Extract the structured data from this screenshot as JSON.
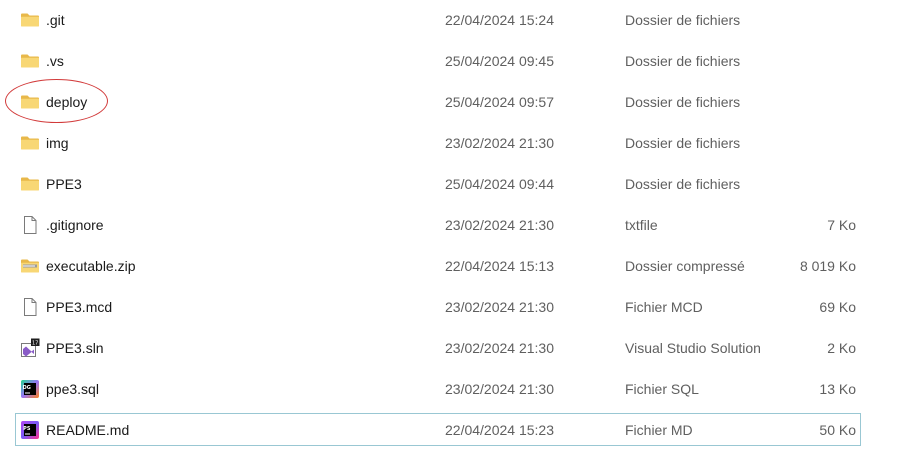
{
  "files": [
    {
      "icon": "folder-icon",
      "name": ".git",
      "date": "22/04/2024 15:24",
      "type": "Dossier de fichiers",
      "size": ""
    },
    {
      "icon": "folder-icon",
      "name": ".vs",
      "date": "25/04/2024 09:45",
      "type": "Dossier de fichiers",
      "size": ""
    },
    {
      "icon": "folder-icon",
      "name": "deploy",
      "date": "25/04/2024 09:57",
      "type": "Dossier de fichiers",
      "size": ""
    },
    {
      "icon": "folder-icon",
      "name": "img",
      "date": "23/02/2024 21:30",
      "type": "Dossier de fichiers",
      "size": ""
    },
    {
      "icon": "folder-icon",
      "name": "PPE3",
      "date": "25/04/2024 09:44",
      "type": "Dossier de fichiers",
      "size": ""
    },
    {
      "icon": "text-file-icon",
      "name": ".gitignore",
      "date": "23/02/2024 21:30",
      "type": "txtfile",
      "size": "7 Ko"
    },
    {
      "icon": "zip-folder-icon",
      "name": "executable.zip",
      "date": "22/04/2024 15:13",
      "type": "Dossier compressé",
      "size": "8 019 Ko"
    },
    {
      "icon": "blank-file-icon",
      "name": "PPE3.mcd",
      "date": "23/02/2024 21:30",
      "type": "Fichier MCD",
      "size": "69 Ko"
    },
    {
      "icon": "visual-studio-solution-icon",
      "name": "PPE3.sln",
      "date": "23/02/2024 21:30",
      "type": "Visual Studio Solution",
      "size": "2 Ko"
    },
    {
      "icon": "datagrip-icon",
      "name": "ppe3.sql",
      "date": "23/02/2024 21:30",
      "type": "Fichier SQL",
      "size": "13 Ko"
    },
    {
      "icon": "phpstorm-icon",
      "name": "README.md",
      "date": "22/04/2024 15:23",
      "type": "Fichier MD",
      "size": "50 Ko"
    }
  ],
  "selected_index": 10,
  "highlighted_index": 2,
  "colors": {
    "folder": "#f8d775",
    "folder_dark": "#e8b84a",
    "selection_border": "#99c7d3",
    "highlight_ellipse": "#d23a3a",
    "secondary_text": "#5f5f5f"
  }
}
